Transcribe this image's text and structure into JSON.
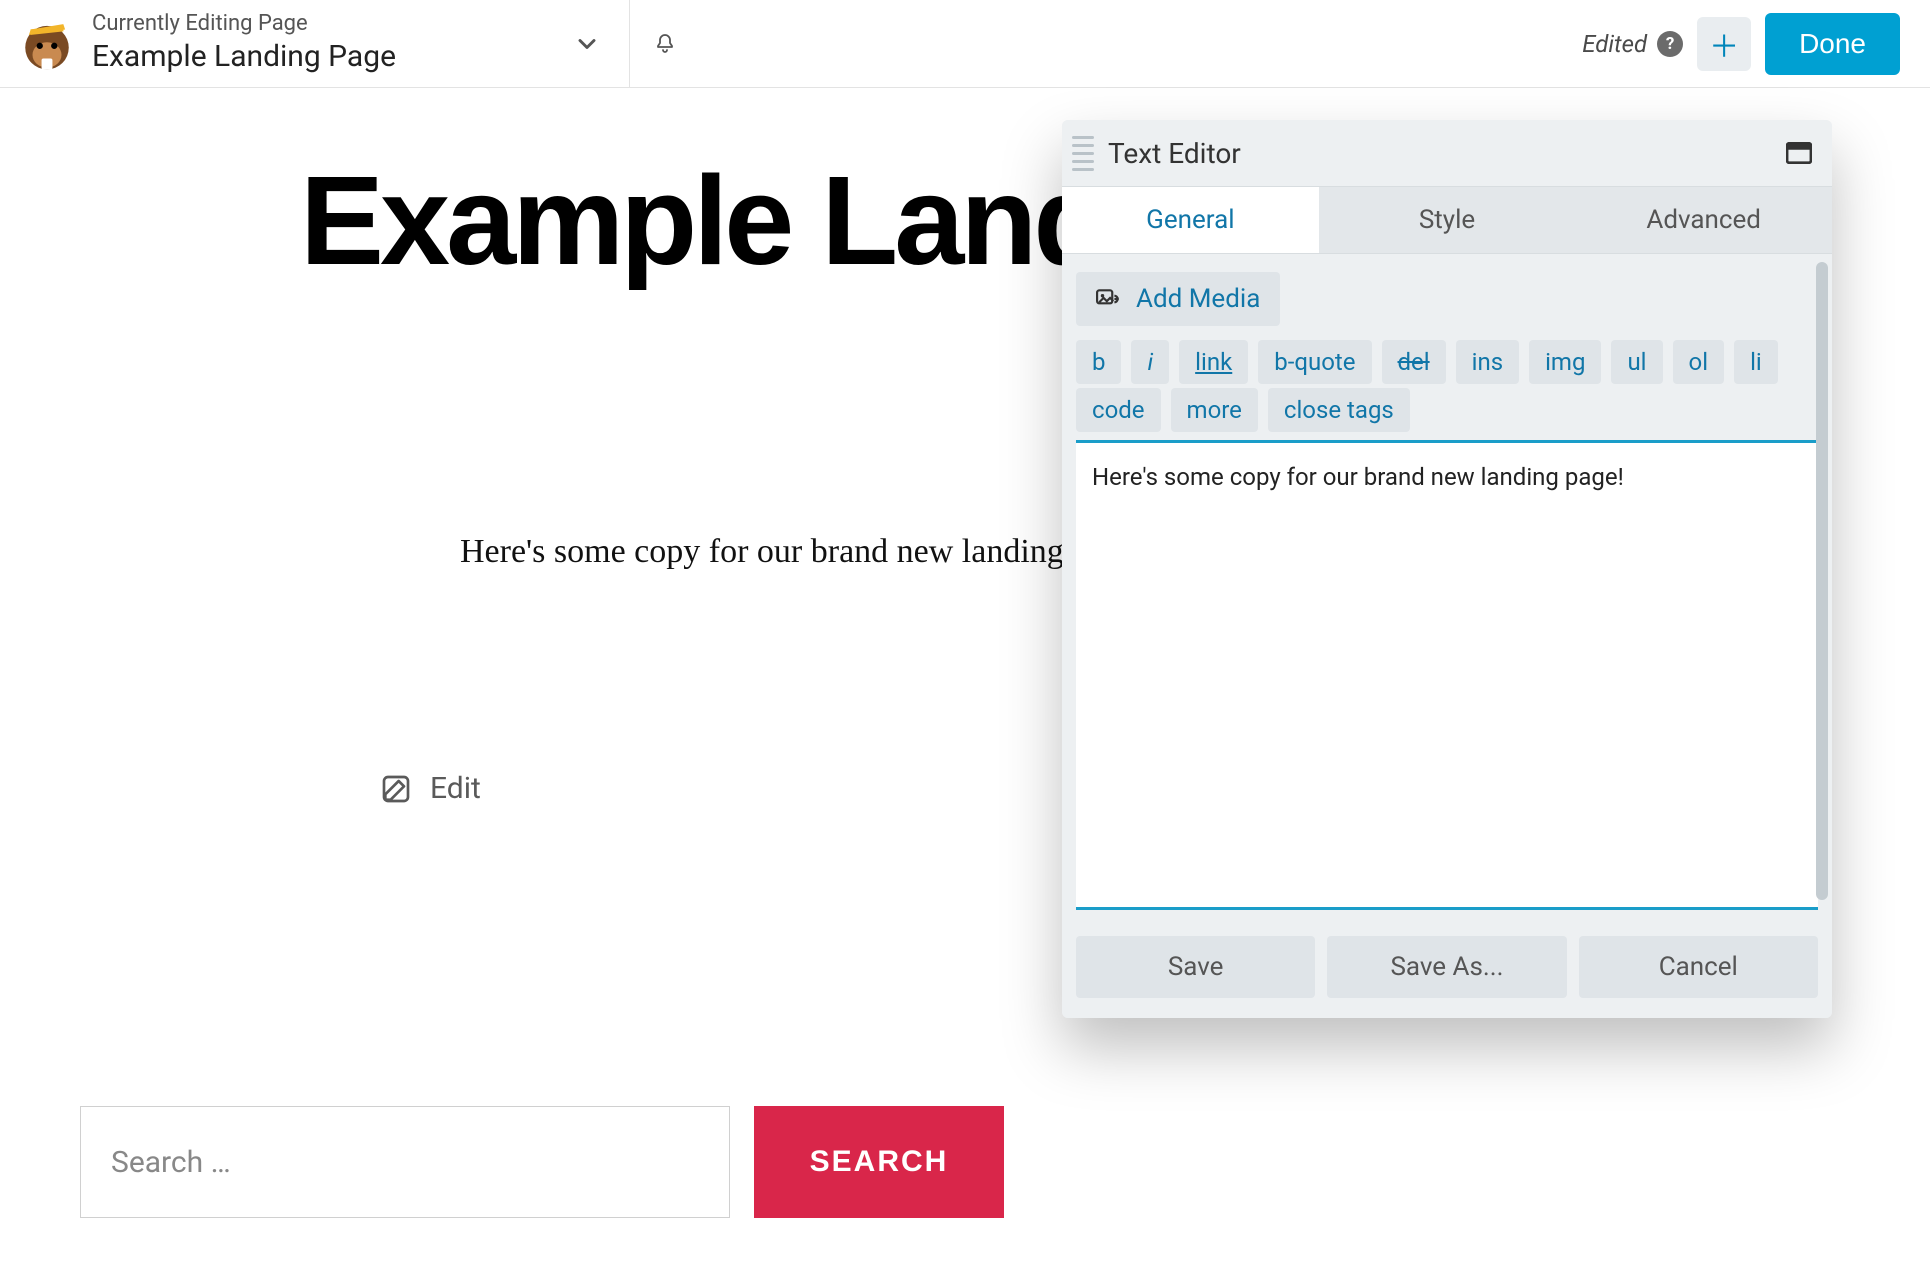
{
  "topbar": {
    "context_label": "Currently Editing Page",
    "page_title": "Example Landing Page",
    "edited_label": "Edited",
    "done_label": "Done"
  },
  "canvas": {
    "heading": "Example Landing Page",
    "copy": "Here's some copy for our brand new landing page!",
    "edit_label": "Edit",
    "search_placeholder": "Search …",
    "search_button": "SEARCH"
  },
  "panel": {
    "title": "Text Editor",
    "tabs": {
      "general": "General",
      "style": "Style",
      "advanced": "Advanced"
    },
    "add_media": "Add Media",
    "tags": {
      "b": "b",
      "i": "i",
      "link": "link",
      "bquote": "b-quote",
      "del": "del",
      "ins": "ins",
      "img": "img",
      "ul": "ul",
      "ol": "ol",
      "li": "li",
      "code": "code",
      "more": "more",
      "close": "close tags"
    },
    "editor_text": "Here's some copy for our brand new landing page!",
    "footer": {
      "save": "Save",
      "saveas": "Save As...",
      "cancel": "Cancel"
    }
  }
}
